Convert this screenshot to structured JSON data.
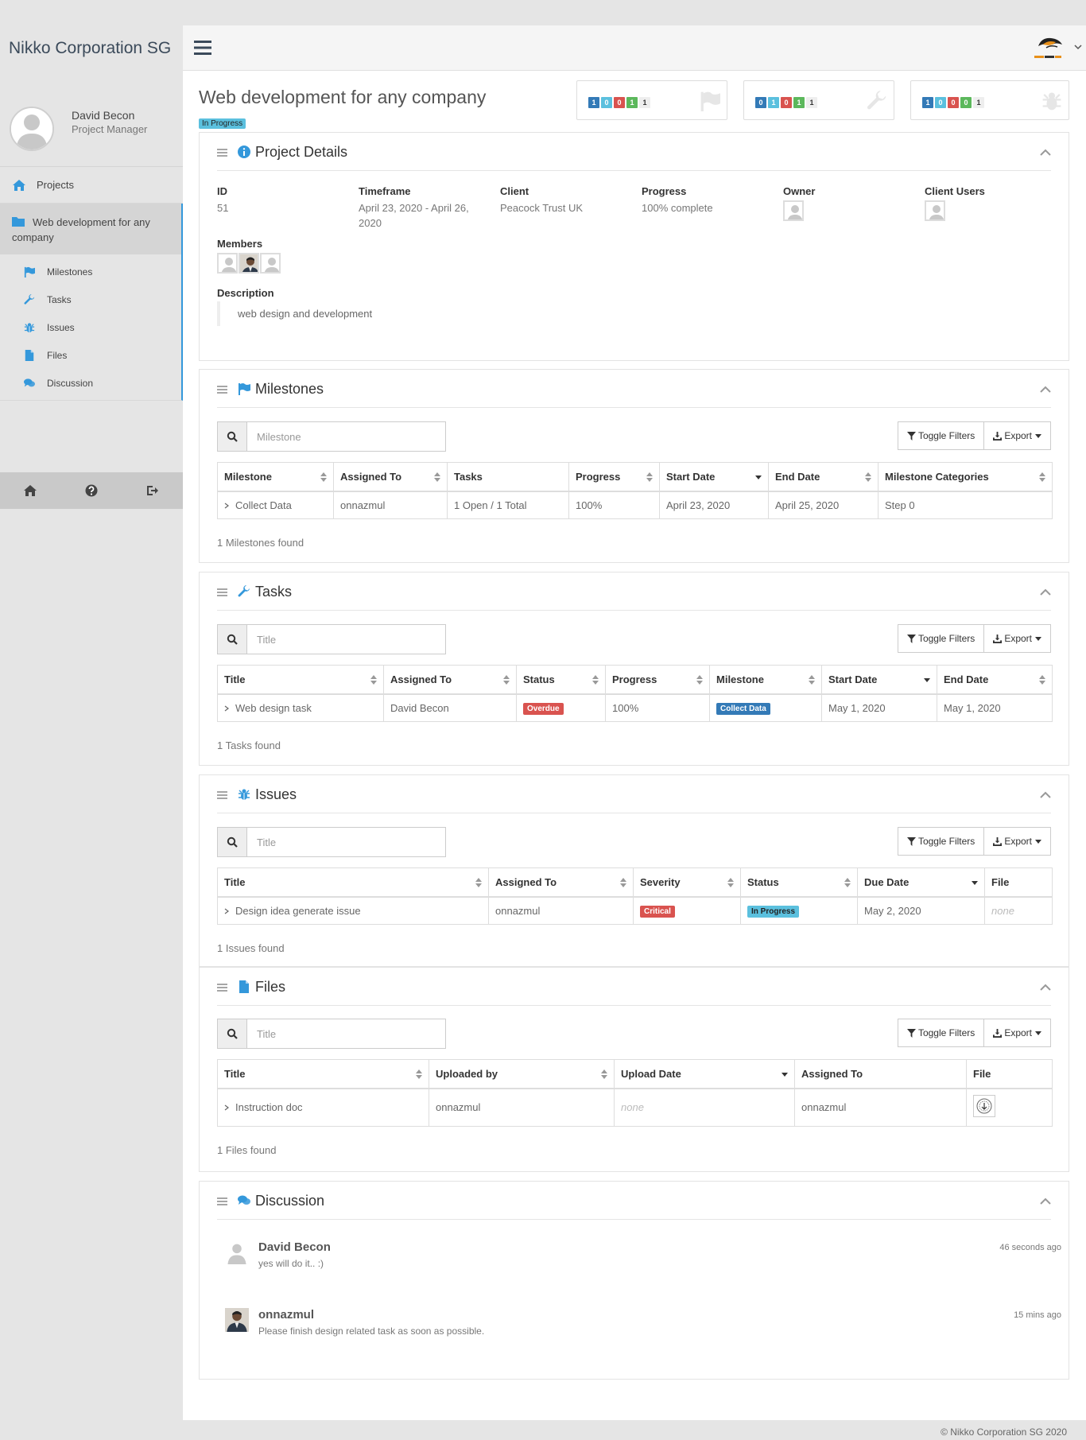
{
  "app": {
    "brand": "Nikko Corporation SG",
    "footer": "© Nikko Corporation SG 2020"
  },
  "user": {
    "name": "David Becon",
    "role": "Project Manager"
  },
  "sidebar": {
    "projects": "Projects",
    "current_project": "Web development for any company",
    "subitems": [
      "Milestones",
      "Tasks",
      "Issues",
      "Files",
      "Discussion"
    ]
  },
  "page": {
    "title": "Web development for any company",
    "status": "In Progress"
  },
  "stats": [
    {
      "icon": "flag-icon",
      "counts": [
        1,
        0,
        0,
        1,
        1
      ]
    },
    {
      "icon": "wrench-icon",
      "counts": [
        0,
        1,
        0,
        1,
        1
      ]
    },
    {
      "icon": "bug-icon",
      "counts": [
        1,
        0,
        0,
        0,
        1
      ]
    }
  ],
  "details": {
    "heading": "Project Details",
    "id_label": "ID",
    "id": "51",
    "timeframe_label": "Timeframe",
    "timeframe": "April 23, 2020 - April 26, 2020",
    "client_label": "Client",
    "client": "Peacock Trust UK",
    "progress_label": "Progress",
    "progress": "100% complete",
    "owner_label": "Owner",
    "client_users_label": "Client Users",
    "members_label": "Members",
    "description_label": "Description",
    "description": "web design and development"
  },
  "controls": {
    "toggle_filters": "Toggle Filters",
    "export": "Export"
  },
  "milestones": {
    "heading": "Milestones",
    "search_placeholder": "Milestone",
    "columns": [
      "Milestone",
      "Assigned To",
      "Tasks",
      "Progress",
      "Start Date",
      "End Date",
      "Milestone Categories"
    ],
    "rows": [
      [
        "Collect Data",
        "onnazmul",
        "1 Open / 1 Total",
        "100%",
        "April 23, 2020",
        "April 25, 2020",
        "Step 0"
      ]
    ],
    "found": "1 Milestones found"
  },
  "tasks": {
    "heading": "Tasks",
    "search_placeholder": "Title",
    "columns": [
      "Title",
      "Assigned To",
      "Status",
      "Progress",
      "Milestone",
      "Start Date",
      "End Date"
    ],
    "row": {
      "title": "Web design task",
      "assigned": "David Becon",
      "status": "Overdue",
      "progress": "100%",
      "milestone": "Collect Data",
      "start": "May 1, 2020",
      "end": "May 1, 2020"
    },
    "found": "1 Tasks found"
  },
  "issues": {
    "heading": "Issues",
    "search_placeholder": "Title",
    "columns": [
      "Title",
      "Assigned To",
      "Severity",
      "Status",
      "Due Date",
      "File"
    ],
    "row": {
      "title": "Design idea generate issue",
      "assigned": "onnazmul",
      "severity": "Critical",
      "status": "In Progress",
      "due": "May 2, 2020",
      "file": "none"
    },
    "found": "1 Issues found"
  },
  "files": {
    "heading": "Files",
    "search_placeholder": "Title",
    "columns": [
      "Title",
      "Uploaded by",
      "Upload Date",
      "Assigned To",
      "File"
    ],
    "row": {
      "title": "Instruction doc",
      "uploaded_by": "onnazmul",
      "upload_date": "none",
      "assigned": "onnazmul"
    },
    "found": "1 Files found"
  },
  "discussion": {
    "heading": "Discussion",
    "messages": [
      {
        "author": "David Becon",
        "text": "yes will do it.. :)",
        "time": "46 seconds ago"
      },
      {
        "author": "onnazmul",
        "text": "Please finish design related task as soon as possible.",
        "time": "15 mins ago"
      }
    ]
  },
  "colors": {
    "accent": "#3498db",
    "danger": "#d9534f",
    "info": "#5bc0de",
    "primary": "#337ab7",
    "success": "#5cb85c"
  }
}
